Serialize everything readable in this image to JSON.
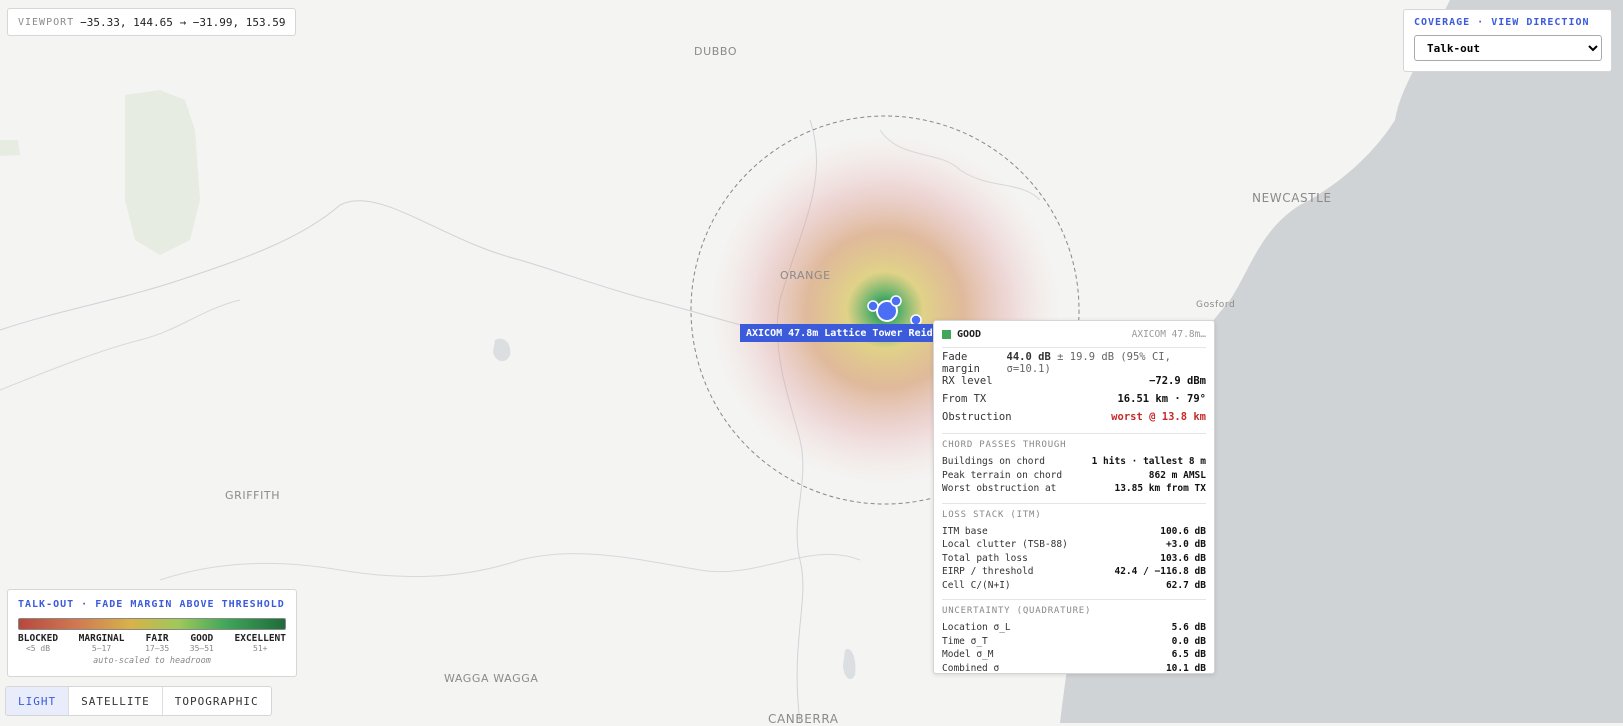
{
  "viewport": {
    "label": "VIEWPORT",
    "bounds": "−35.33, 144.65 → −31.99, 153.59"
  },
  "coverage": {
    "title": "COVERAGE · VIEW DIRECTION",
    "selected": "Talk-out"
  },
  "cities": [
    {
      "name": "DUBBO"
    },
    {
      "name": "ORANGE"
    },
    {
      "name": "NEWCASTLE"
    },
    {
      "name": "Gosford"
    },
    {
      "name": "GRIFFITH"
    },
    {
      "name": "WAGGA WAGGA"
    },
    {
      "name": "CANBERRA"
    }
  ],
  "site_tag": "AXICOM 47.8m Lattice Tower Reid Pa",
  "popup": {
    "status": "GOOD",
    "status_color": "#3fa65a",
    "site": "AXICOM 47.8m…",
    "fade_label": "Fade margin",
    "fade_value": "44.0 dB",
    "fade_ci": "± 19.9 dB (95% CI, σ=10.1)",
    "rx_label": "RX level",
    "rx_value": "−72.9 dBm",
    "from_label": "From TX",
    "from_value": "16.51 km · 79°",
    "obs_label": "Obstruction",
    "obs_value": "worst @ 13.8 km",
    "chord_title": "CHORD PASSES THROUGH",
    "chord": [
      {
        "k": "Buildings on chord",
        "v": "1 hits · tallest 8 m"
      },
      {
        "k": "Peak terrain on chord",
        "v": "862 m AMSL"
      },
      {
        "k": "Worst obstruction at",
        "v": "13.85 km from TX"
      }
    ],
    "loss_title": "LOSS STACK (ITM)",
    "loss": [
      {
        "k": "ITM base",
        "v": "100.6 dB"
      },
      {
        "k": "Local clutter (TSB-88)",
        "v": "+3.0 dB"
      },
      {
        "k": "Total path loss",
        "v": "103.6 dB"
      },
      {
        "k": "EIRP / threshold",
        "v": "42.4 / −116.8 dB"
      },
      {
        "k": "Cell C/(N+I)",
        "v": "62.7 dB"
      }
    ],
    "unc_title": "UNCERTAINTY (QUADRATURE)",
    "unc": [
      {
        "k": "Location σ_L",
        "v": "5.6 dB"
      },
      {
        "k": "Time σ_T",
        "v": "0.0 dB"
      },
      {
        "k": "Model σ_M",
        "v": "6.5 dB"
      },
      {
        "k": "Combined σ",
        "v": "10.1 dB"
      }
    ]
  },
  "legend": {
    "title": "TALK-OUT · FADE MARGIN ABOVE THRESHOLD",
    "cats": [
      {
        "n": "BLOCKED",
        "r": "<5 dB"
      },
      {
        "n": "MARGINAL",
        "r": "5–17"
      },
      {
        "n": "FAIR",
        "r": "17–35"
      },
      {
        "n": "GOOD",
        "r": "35–51"
      },
      {
        "n": "EXCELLENT",
        "r": "51+"
      }
    ],
    "note": "auto-scaled to headroom"
  },
  "basemap": [
    {
      "label": "LIGHT",
      "active": true
    },
    {
      "label": "SATELLITE",
      "active": false
    },
    {
      "label": "TOPOGRAPHIC",
      "active": false
    }
  ],
  "colors": {
    "accent": "#3b5bdb",
    "ocean": "#cfd3d6",
    "land": "#f4f4f2",
    "obstruction": "#c92a2a"
  }
}
